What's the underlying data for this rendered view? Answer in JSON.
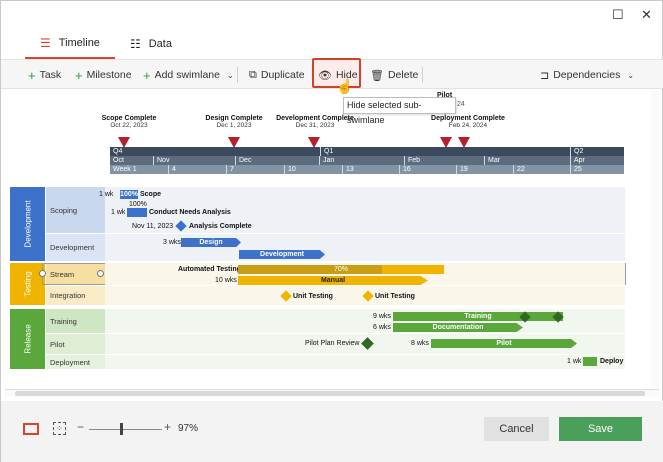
{
  "window": {
    "maximize_glyph": "☐",
    "close_glyph": "✕"
  },
  "tabs": [
    {
      "label": "Timeline",
      "icon": "timeline-icon",
      "active": true
    },
    {
      "label": "Data",
      "icon": "list-icon",
      "active": false
    }
  ],
  "toolbar": {
    "task": "Task",
    "milestone": "Milestone",
    "add_swimlane": "Add swimlane",
    "duplicate": "Duplicate",
    "hide": "Hide",
    "delete": "Delete",
    "dependencies": "Dependencies"
  },
  "tooltip": "Hide selected sub-swimlane",
  "milestones": [
    {
      "name": "Scope Complete",
      "date": "Oct 22, 2023"
    },
    {
      "name": "Design Complete",
      "date": "Dec 1, 2023"
    },
    {
      "name": "Development Complete",
      "date": "Dec 31, 2023"
    },
    {
      "name": "Deployment Complete",
      "date": "Feb 24, 2024"
    },
    {
      "name": "Pilot",
      "date": "24"
    }
  ],
  "scale": {
    "quarters": [
      "Q4",
      "Q1",
      "Q2"
    ],
    "months": [
      "Oct",
      "Nov",
      "Dec",
      "Jan",
      "Feb",
      "Mar",
      "Apr"
    ],
    "weeks": [
      "Week 1",
      "4",
      "7",
      "10",
      "13",
      "16",
      "19",
      "22",
      "25"
    ],
    "colors": {
      "quarter": "#3b4a5c",
      "month": "#5c6b7d",
      "week": "#8393a6"
    }
  },
  "swimlanes": [
    {
      "name": "Development",
      "color": "#3c72c9",
      "subs": [
        "Scoping",
        "Development"
      ],
      "items": {
        "scope_dur": "1 wk",
        "scope_pct": "100%",
        "scope_name": "Scope",
        "cna_dur": "1 wk",
        "cna_pct": "100%",
        "cna_name": "Conduct Needs Analysis",
        "ac_date": "Nov 11, 2023",
        "ac_name": "Analysis Complete",
        "design_dur": "3 wks",
        "design_name": "Design",
        "dev_name": "Development"
      }
    },
    {
      "name": "Testing",
      "color": "#f0b400",
      "subs": [
        "Stream",
        "Integration"
      ],
      "items": {
        "at_name": "Automated Testing",
        "at_pct": "70%",
        "man_dur": "10 wks",
        "man_name": "Manual",
        "ut1_name": "Unit Testing",
        "ut2_name": "Unit Testing"
      }
    },
    {
      "name": "Release",
      "color": "#5aa83c",
      "subs": [
        "Training",
        "Pilot",
        "Deployment"
      ],
      "items": {
        "tr_dur": "9 wks",
        "tr_name": "Training",
        "doc_dur": "6 wks",
        "doc_name": "Documentation",
        "ppr_name": "Pilot Plan Review",
        "pilot_dur": "8 wks",
        "pilot_name": "Pilot",
        "dep_dur": "1 wk",
        "dep_name": "Deploy"
      }
    }
  ],
  "footer": {
    "zoom": "97%",
    "cancel": "Cancel",
    "save": "Save"
  }
}
